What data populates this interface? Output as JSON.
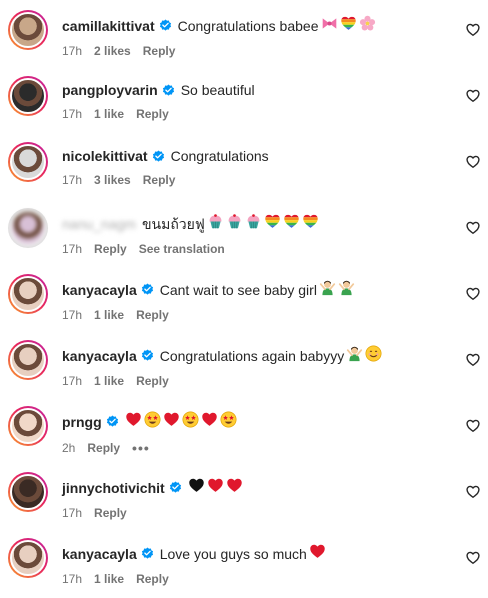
{
  "colors": {
    "text": "#262626",
    "meta": "#737373",
    "verified": "#0095f6",
    "red_heart": "#e0182d",
    "ring_gradient": [
      "#f9a02b",
      "#e7265f",
      "#c024a6"
    ]
  },
  "comments": [
    {
      "username": "camillakittivat",
      "verified": true,
      "text": "Congratulations babee",
      "emoji": [
        "bow-emoji",
        "rainbow-heart-emoji",
        "cherry-blossom-emoji"
      ],
      "time": "17h",
      "likes": "2 likes",
      "reply": "Reply",
      "extra": ""
    },
    {
      "username": "pangployvarin",
      "verified": true,
      "text": "So beautiful",
      "emoji": [],
      "time": "17h",
      "likes": "1 like",
      "reply": "Reply",
      "extra": ""
    },
    {
      "username": "nicolekittivat",
      "verified": true,
      "text": "Congratulations",
      "emoji": [],
      "time": "17h",
      "likes": "3 likes",
      "reply": "Reply",
      "extra": ""
    },
    {
      "username": "nanu_nagm",
      "username_blurred": true,
      "verified": false,
      "text": "ขนมถ้วยฟู",
      "emoji": [
        "cupcake-emoji",
        "cupcake-emoji",
        "cupcake-emoji",
        "rainbow-heart-emoji",
        "rainbow-heart-emoji",
        "rainbow-heart-emoji"
      ],
      "time": "17h",
      "likes": "",
      "reply": "Reply",
      "extra": "See translation"
    },
    {
      "username": "kanyacayla",
      "verified": true,
      "text": "Cant wait to see baby girl",
      "emoji": [
        "woman-gesturing-emoji",
        "woman-gesturing-emoji"
      ],
      "time": "17h",
      "likes": "1 like",
      "reply": "Reply",
      "extra": ""
    },
    {
      "username": "kanyacayla",
      "verified": true,
      "text": "Congratulations again babyyy",
      "emoji": [
        "woman-gesturing-emoji",
        "smiling-face-emoji"
      ],
      "time": "17h",
      "likes": "1 like",
      "reply": "Reply",
      "extra": ""
    },
    {
      "username": "prngg",
      "verified": true,
      "text": "",
      "emoji": [
        "red-heart-emoji",
        "star-struck-emoji",
        "red-heart-emoji",
        "star-struck-emoji",
        "red-heart-emoji",
        "star-struck-emoji"
      ],
      "time": "2h",
      "likes": "",
      "reply": "Reply",
      "extra": "•••"
    },
    {
      "username": "jinnychotivichit",
      "verified": true,
      "text": "",
      "emoji": [
        "black-heart-emoji",
        "red-heart-emoji",
        "red-heart-emoji"
      ],
      "time": "17h",
      "likes": "",
      "reply": "Reply",
      "extra": ""
    },
    {
      "username": "kanyacayla",
      "verified": true,
      "text": "Love you guys so much",
      "emoji": [
        "red-heart-emoji"
      ],
      "time": "17h",
      "likes": "1 like",
      "reply": "Reply",
      "extra": ""
    }
  ]
}
